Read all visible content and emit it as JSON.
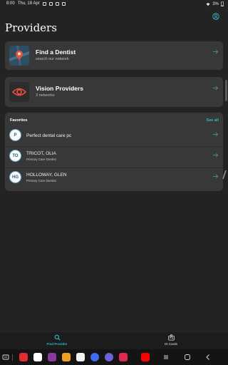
{
  "status_bar": {
    "time": "8:00",
    "date": "Thu, 18 Apr",
    "battery": "3%"
  },
  "header": {
    "title": "Providers",
    "profile_icon": "account-circle-icon"
  },
  "cards": {
    "find_dentist": {
      "title": "Find a Dentist",
      "subtitle": "search our network",
      "icon": "map-pin-icon"
    },
    "vision": {
      "title": "Vision Providers",
      "subtitle": "3 networks",
      "icon": "eye-icon"
    }
  },
  "favorites": {
    "header": "Favorites",
    "see_all": "See all",
    "items": [
      {
        "initials": "P",
        "name": "Perfect dental care pc",
        "role": ""
      },
      {
        "initials": "TO",
        "name": "TRICOT, OLIA",
        "role": "Primary Care Dentist"
      },
      {
        "initials": "HG",
        "name": "HOLLOWAY, GLEN",
        "role": "Primary Care Dentist"
      }
    ]
  },
  "bottom_nav": {
    "items": [
      {
        "label": "Find Provider",
        "icon": "search-icon",
        "active": true
      },
      {
        "label": "ID Cards",
        "icon": "id-card-icon",
        "active": false
      }
    ]
  },
  "colors": {
    "background": "#232323",
    "card": "#383838",
    "accent": "#36b7c7",
    "map_tile": "#2f4e63",
    "eye_icon": "#e0553a"
  },
  "dock": {
    "apps": [
      "flipboard-app",
      "files-app",
      "calendar-app",
      "messages-app",
      "chat-app",
      "screen-recorder-app",
      "youtube-app"
    ]
  }
}
